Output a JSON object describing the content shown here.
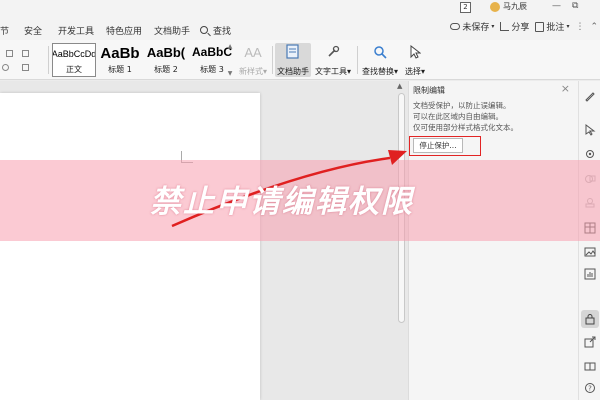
{
  "menu": {
    "items": [
      "节",
      "安全",
      "开发工具",
      "特色应用",
      "文档助手",
      "查找"
    ]
  },
  "titlebar": {
    "badge": "2",
    "user": "马九辰",
    "unsaved": "未保存",
    "share": "分享",
    "annotate": "批注"
  },
  "ribbon": {
    "styles": [
      {
        "sample": "AaBbCcDd",
        "label": "正文"
      },
      {
        "sample": "AaBb",
        "label": "标题 1"
      },
      {
        "sample": "AaBb(",
        "label": "标题 2"
      },
      {
        "sample": "AaBbC",
        "label": "标题 3"
      }
    ],
    "new_style": "新样式",
    "doc_assistant": "文档助手",
    "text_tools": "文字工具",
    "find_replace": "查找替换",
    "select": "选择"
  },
  "panel": {
    "title": "限制编辑",
    "desc_lines": [
      "文档受保护，以防止误编辑。",
      "可以在此区域内自由编辑。",
      "仅可使用部分样式格式化文本。"
    ],
    "stop_button": "停止保护..."
  },
  "banner": {
    "text": "禁止申请编辑权限"
  },
  "colors": {
    "banner": "#f79eaf",
    "highlight": "#e22424",
    "arrow": "#e02020"
  }
}
